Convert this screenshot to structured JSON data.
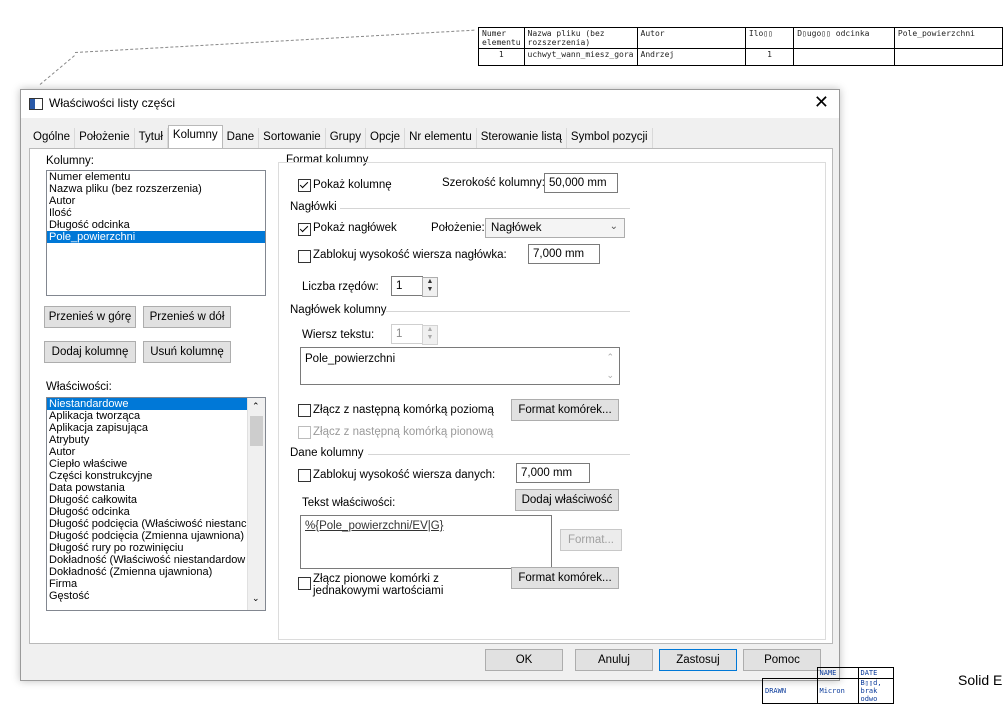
{
  "background_drawing": {
    "table_headers": [
      "Numer elementu",
      "Nazwa pliku (bez rozszerzenia)",
      "Autor",
      "Ilo\u0000\u0000",
      "D\u0000ugo\u0000\u0000 odcinka",
      "Pole_powierzchni"
    ],
    "header_display": {
      "numer": "Numer elementu",
      "nazwa": "Nazwa pliku (bez rozszerzenia)",
      "autor": "Autor",
      "ilosc": "Ilo▯▯",
      "dlugosc": "D▯ugo▯▯ odcinka",
      "pole": "Pole_powierzchni"
    },
    "row": {
      "numer": "1",
      "nazwa": "uchwyt_wann_miesz_gora",
      "autor": "Andrzej",
      "ilosc": "1",
      "dlugosc": "",
      "pole": ""
    },
    "frame": {
      "name_label": "NAME",
      "date_label": "DATE",
      "drawn_label": "DRAWN",
      "drawn_name": "Micron",
      "drawn_date": "B▯▯d, brak odwo",
      "brand": "Solid E"
    }
  },
  "dialog": {
    "title": "Właściwości listy części",
    "close_label": "✕",
    "tabs": [
      "Ogólne",
      "Położenie",
      "Tytuł",
      "Kolumny",
      "Dane",
      "Sortowanie",
      "Grupy",
      "Opcje",
      "Nr elementu",
      "Sterowanie listą",
      "Symbol pozycji"
    ],
    "active_tab": "Kolumny",
    "left": {
      "columns_label": "Kolumny:",
      "columns": [
        "Numer elementu",
        "Nazwa pliku (bez rozszerzenia)",
        "Autor",
        "Ilość",
        "Długość odcinka",
        "Pole_powierzchni"
      ],
      "selected_column": "Pole_powierzchni",
      "move_up": "Przenieś w górę",
      "move_down": "Przenieś w dół",
      "add_column": "Dodaj kolumnę",
      "remove_column": "Usuń kolumnę",
      "properties_label": "Właściwości:",
      "properties": [
        "Niestandardowe",
        "Aplikacja tworząca",
        "Aplikacja zapisująca",
        "Atrybuty",
        "Autor",
        "Ciepło właściwe",
        "Części konstrukcyjne",
        "Data powstania",
        "Długość całkowita",
        "Długość odcinka",
        "Długość podcięcia (Właściwość niestanc",
        "Długość podcięcia (Zmienna ujawniona)",
        "Długość rury po rozwinięciu",
        "Dokładność (Właściwość niestandardow",
        "Dokładność (Zmienna ujawniona)",
        "Firma",
        "Gęstość"
      ],
      "selected_property": "Niestandardowe"
    },
    "format": {
      "group_title": "Format kolumny",
      "show_column": "Pokaż kolumnę",
      "show_column_checked": true,
      "width_label": "Szerokość kolumny:",
      "width_value": "50,000 mm",
      "headers_title": "Nagłówki",
      "show_header": "Pokaż nagłówek",
      "show_header_checked": true,
      "position_label": "Położenie:",
      "position_value": "Nagłówek",
      "lock_header_height": "Zablokuj wysokość wiersza nagłówka:",
      "lock_header_height_checked": false,
      "header_height_value": "7,000 mm",
      "rows_label": "Liczba rzędów:",
      "rows_value": "1",
      "column_header_title": "Nagłówek kolumny",
      "text_row_label": "Wiersz tekstu:",
      "text_row_value": "1",
      "header_text": "Pole_powierzchni",
      "merge_horizontal": "Złącz z następną komórką poziomą",
      "merge_horizontal_checked": false,
      "format_cells": "Format komórek...",
      "merge_vertical": "Złącz z następną komórką pionową",
      "column_data_title": "Dane kolumny",
      "lock_data_height": "Zablokuj wysokość wiersza danych:",
      "lock_data_height_checked": false,
      "data_height_value": "7,000 mm",
      "property_text_label": "Tekst właściwości:",
      "add_property": "Dodaj właściwość",
      "property_text": "%{Pole_powierzchni/EV|G}",
      "format_button": "Format...",
      "merge_vertical_same": "Złącz pionowe komórki z jednakowymi wartościami",
      "merge_vertical_same_line1": "Złącz pionowe komórki z",
      "merge_vertical_same_line2": "jednakowymi wartościami",
      "merge_vertical_same_checked": false,
      "format_cells_2": "Format komórek..."
    },
    "footer": {
      "ok": "OK",
      "cancel": "Anuluj",
      "apply": "Zastosuj",
      "help": "Pomoc"
    }
  }
}
